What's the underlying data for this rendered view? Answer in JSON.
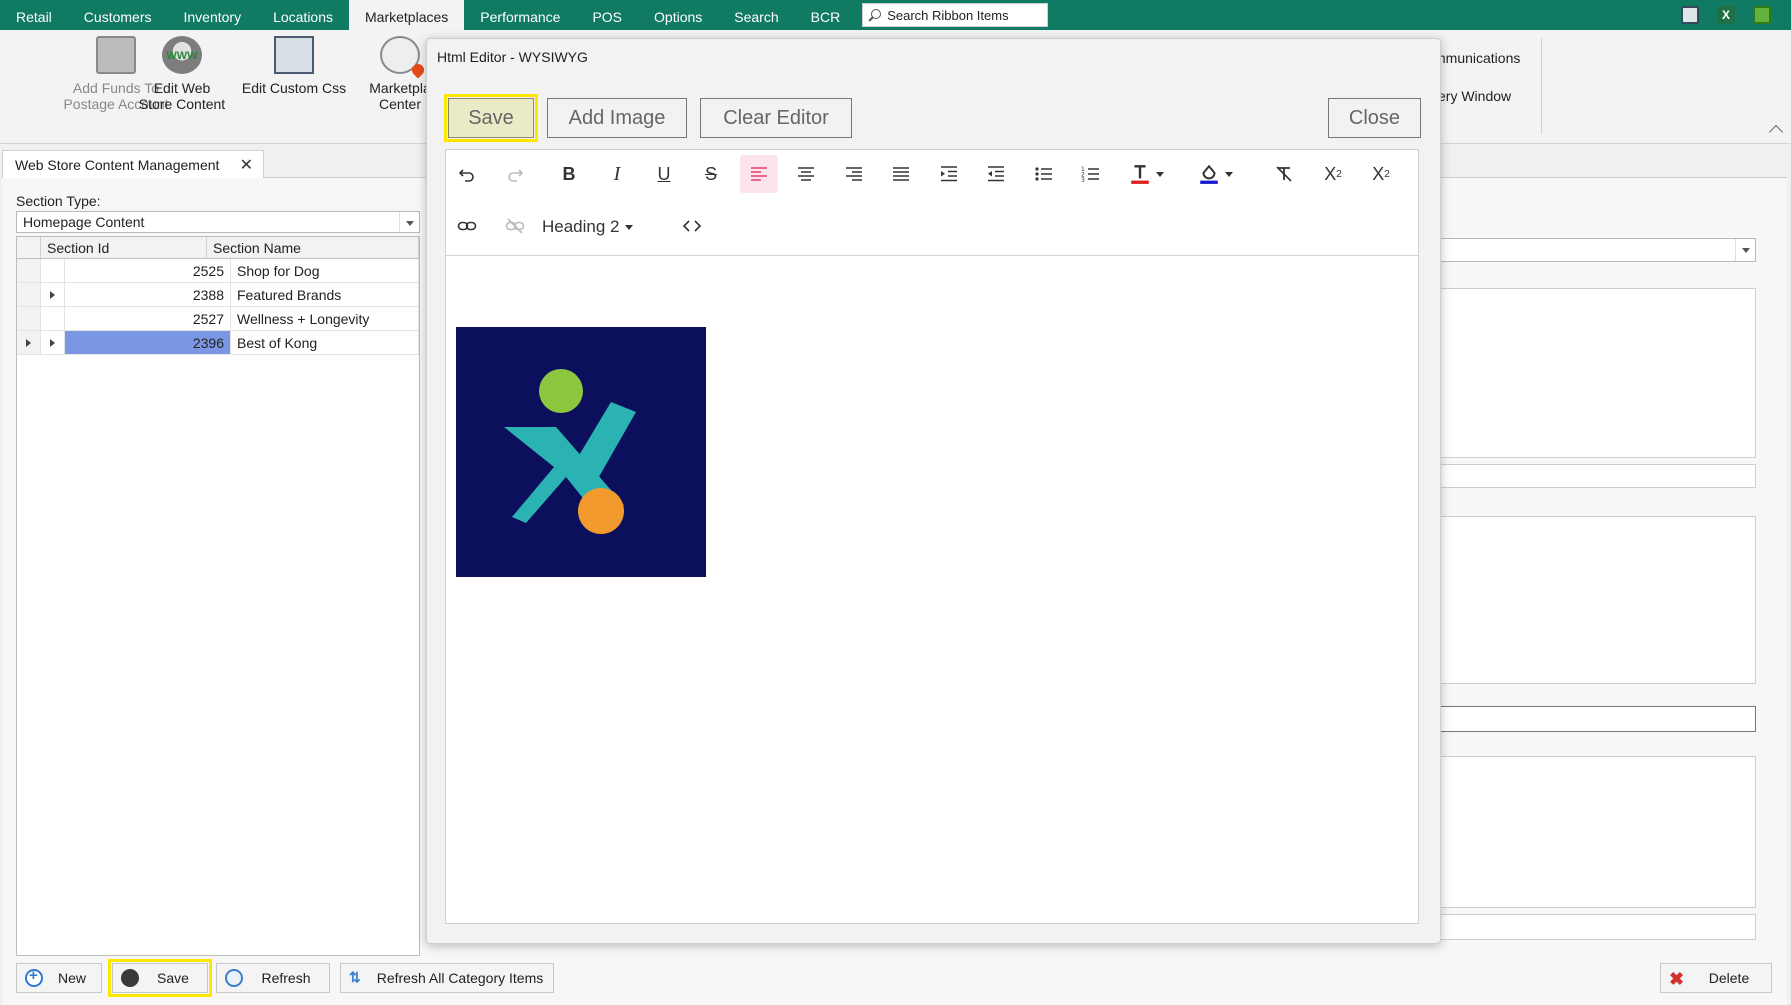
{
  "top_tabs": [
    "Retail",
    "Customers",
    "Inventory",
    "Locations",
    "Marketplaces",
    "Performance",
    "POS",
    "Options",
    "Search",
    "BCR"
  ],
  "active_tab": "Marketplaces",
  "ribbon_search_placeholder": "Search Ribbon Items",
  "ribbon": {
    "add_funds": "Add Funds To\nPostage Account",
    "edit_web": "Edit Web\nStore Content",
    "edit_css": "Edit Custom Css",
    "marketplace": "Marketpla\nCenter",
    "www_label": "WWW",
    "communications": "mmunications",
    "query_window": "ery Window"
  },
  "doc_tab": {
    "label": "Web Store Content Management",
    "close": "✕"
  },
  "section_type": {
    "label": "Section Type:",
    "value": "Homepage Content"
  },
  "grid": {
    "headers": [
      "Section Id",
      "Section Name"
    ],
    "rows": [
      {
        "id": "2525",
        "name": "Shop for Dog",
        "expandable": false,
        "current": false,
        "selected": false
      },
      {
        "id": "2388",
        "name": "Featured Brands",
        "expandable": true,
        "current": false,
        "selected": false
      },
      {
        "id": "2527",
        "name": "Wellness + Longevity",
        "expandable": false,
        "current": false,
        "selected": false
      },
      {
        "id": "2396",
        "name": "Best of Kong",
        "expandable": true,
        "current": true,
        "selected": true
      }
    ]
  },
  "bottom_buttons": {
    "new": "New",
    "save": "Save",
    "refresh": "Refresh",
    "refresh_all": "Refresh All Category Items",
    "delete": "Delete"
  },
  "modal": {
    "title": "Html Editor - WYSIWYG",
    "save": "Save",
    "add_image": "Add Image",
    "clear_editor": "Clear Editor",
    "close": "Close",
    "heading_select": "Heading 2"
  },
  "colors": {
    "brand_green": "#117a63",
    "highlight": "#ffe600",
    "selected_row": "#7b96e3",
    "text_color_swatch": "#e02020",
    "bg_color_swatch": "#1a1ad0",
    "logo_bg": "#0b0f5c"
  }
}
